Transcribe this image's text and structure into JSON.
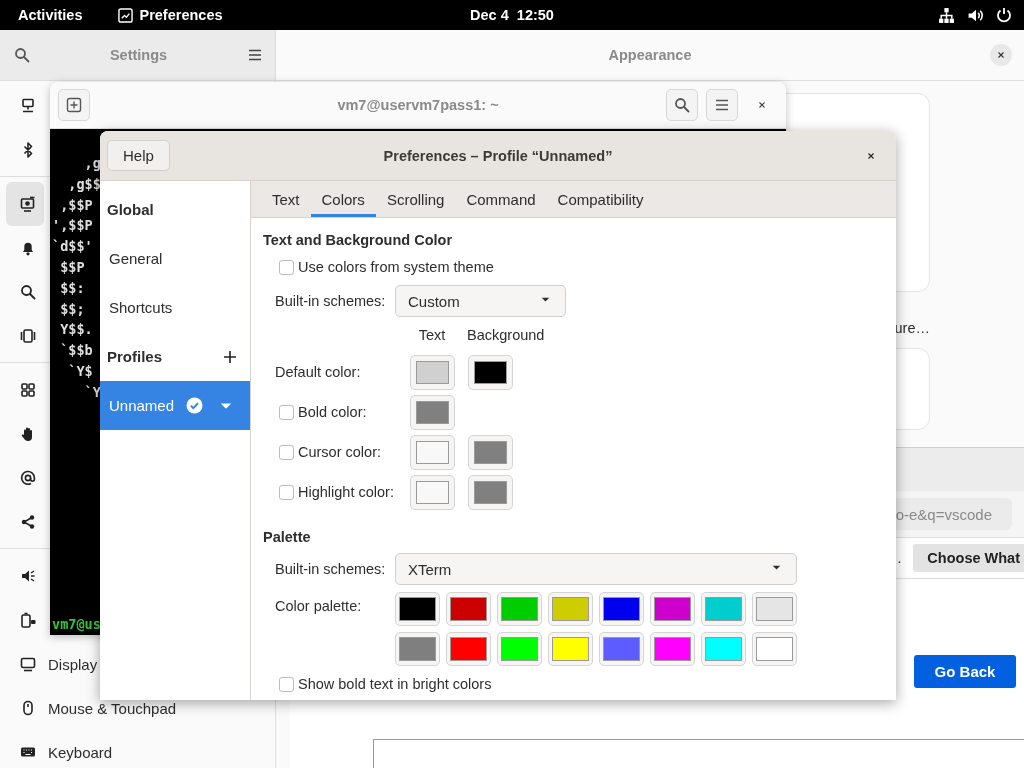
{
  "top_bar": {
    "activities": "Activities",
    "app": "Preferences",
    "clock": "Dec 4  12:50"
  },
  "settings": {
    "title": "Settings",
    "pane_title": "Appearance",
    "fragment": "ure…",
    "sidebar": [
      [
        {
          "selected": false
        },
        {
          "selected": false
        }
      ],
      [
        {
          "selected": true
        },
        {
          "selected": false
        },
        {
          "selected": false
        },
        {
          "selected": false
        }
      ],
      [
        {
          "selected": false
        },
        {
          "selected": false
        },
        {
          "selected": false
        },
        {
          "selected": false
        }
      ],
      [
        {
          "selected": false
        },
        {
          "selected": false
        },
        {
          "selected": false,
          "label": "Display"
        },
        {
          "selected": false,
          "label": "Mouse & Touchpad"
        },
        {
          "selected": false,
          "label": "Keyboard"
        }
      ]
    ]
  },
  "terminal": {
    "title": "vm7@uservm7pass1: ~",
    "lines": [
      "    ,g",
      "  ,g$$",
      " ,$$P",
      "',$$P",
      "`d$$'",
      " $$P",
      " $$:",
      " $$;",
      " Y$$.",
      " `$$b",
      "  `Y$",
      "    `Y"
    ],
    "prompt": "vm7@us"
  },
  "browser": {
    "address": "o-e&q=vscode",
    "fragment": ".",
    "choose_button": "Choose What",
    "go_back": "Go Back"
  },
  "dialog": {
    "help": "Help",
    "title": "Preferences – Profile “Unnamed”",
    "nav": [
      {
        "kind": "heading",
        "label": "Global"
      },
      {
        "kind": "item",
        "label": "General",
        "selected": false
      },
      {
        "kind": "item",
        "label": "Shortcuts",
        "selected": false
      },
      {
        "kind": "heading",
        "label": "Profiles"
      },
      {
        "kind": "profile",
        "label": "Unnamed",
        "selected": true
      }
    ],
    "tabs": [
      {
        "label": "Text",
        "selected": false
      },
      {
        "label": "Colors",
        "selected": true
      },
      {
        "label": "Scrolling",
        "selected": false
      },
      {
        "label": "Command",
        "selected": false
      },
      {
        "label": "Compatibility",
        "selected": false
      }
    ],
    "text_colors": {
      "heading": "Text and Background Color",
      "system_theme": {
        "label": "Use colors from system theme",
        "checked": false
      },
      "schemes": {
        "label": "Built-in schemes:",
        "value": "Custom"
      },
      "columns": [
        "Text",
        "Background"
      ],
      "rows": [
        {
          "kind": "plain",
          "label": "Default color:",
          "swatches": [
            {
              "color": "#d0d0d0"
            },
            {
              "color": "#000000"
            }
          ]
        },
        {
          "kind": "checkbox",
          "label": "Bold color:",
          "checked": false,
          "swatches": [
            {
              "color": "#808080"
            }
          ]
        },
        {
          "kind": "checkbox",
          "label": "Cursor color:",
          "checked": false,
          "swatches": [
            {
              "color": "#f8f8f8"
            },
            {
              "color": "#808080"
            }
          ]
        },
        {
          "kind": "checkbox",
          "label": "Highlight color:",
          "checked": false,
          "swatches": [
            {
              "color": "#f8f8f8"
            },
            {
              "color": "#808080"
            }
          ]
        }
      ]
    },
    "palette": {
      "heading": "Palette",
      "schemes": {
        "label": "Built-in schemes:",
        "value": "XTerm"
      },
      "label": "Color palette:",
      "colors": [
        [
          {
            "color": "#000000"
          },
          {
            "color": "#cd0000"
          },
          {
            "color": "#00cd00"
          },
          {
            "color": "#cdcd00"
          },
          {
            "color": "#0000ee"
          },
          {
            "color": "#cd00cd"
          },
          {
            "color": "#00cdcd"
          },
          {
            "color": "#e5e5e5"
          }
        ],
        [
          {
            "color": "#7f7f7f"
          },
          {
            "color": "#ff0000"
          },
          {
            "color": "#00ff00"
          },
          {
            "color": "#ffff00"
          },
          {
            "color": "#5c5cff"
          },
          {
            "color": "#ff00ff"
          },
          {
            "color": "#00ffff"
          },
          {
            "color": "#ffffff"
          }
        ]
      ],
      "bright": {
        "label": "Show bold text in bright colors",
        "checked": false
      }
    }
  }
}
